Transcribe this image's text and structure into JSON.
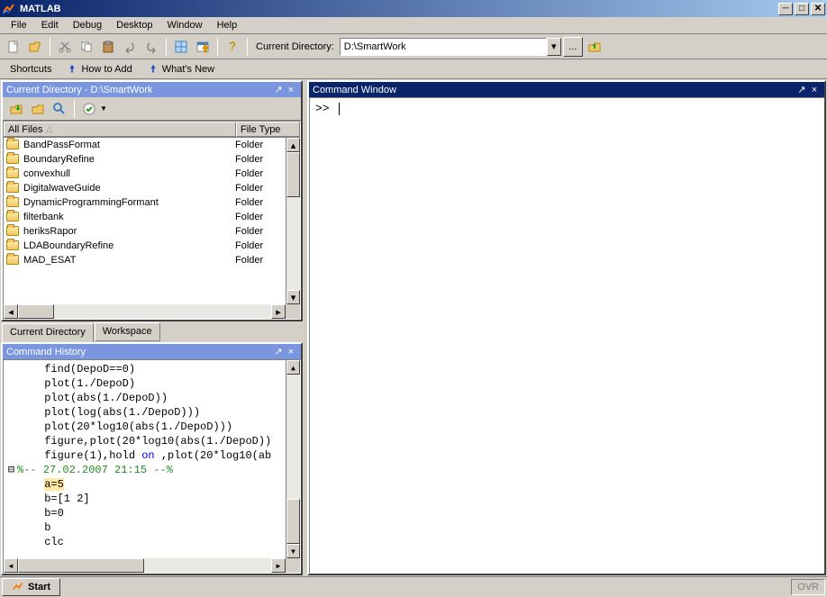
{
  "title": "MATLAB",
  "menubar": [
    "File",
    "Edit",
    "Debug",
    "Desktop",
    "Window",
    "Help"
  ],
  "toolbar": {
    "curdir_label": "Current Directory:",
    "curdir_value": "D:\\SmartWork"
  },
  "shortcuts": {
    "label": "Shortcuts",
    "howto": "How to Add",
    "whatsnew": "What's New"
  },
  "curdir_panel": {
    "title": "Current Directory - D:\\SmartWork",
    "cols": {
      "allfiles": "All Files",
      "filetype": "File Type"
    },
    "rows": [
      {
        "name": "BandPassFormat",
        "type": "Folder"
      },
      {
        "name": "BoundaryRefine",
        "type": "Folder"
      },
      {
        "name": "convexhull",
        "type": "Folder"
      },
      {
        "name": "DigitalwaveGuide",
        "type": "Folder"
      },
      {
        "name": "DynamicProgrammingFormant",
        "type": "Folder"
      },
      {
        "name": "filterbank",
        "type": "Folder"
      },
      {
        "name": "heriksRapor",
        "type": "Folder"
      },
      {
        "name": "LDABoundaryRefine",
        "type": "Folder"
      },
      {
        "name": "MAD_ESAT",
        "type": "Folder"
      }
    ],
    "tabs": {
      "current": "Current Directory",
      "workspace": "Workspace"
    }
  },
  "history_panel": {
    "title": "Command History",
    "lines": [
      {
        "indent": 3,
        "text": "find(DepoD==0)"
      },
      {
        "indent": 3,
        "text": "plot(1./DepoD)"
      },
      {
        "indent": 3,
        "text": "plot(abs(1./DepoD))"
      },
      {
        "indent": 3,
        "text": "plot(log(abs(1./DepoD)))"
      },
      {
        "indent": 3,
        "text": "plot(20*log10(abs(1./DepoD)))"
      },
      {
        "indent": 3,
        "text": "figure,plot(20*log10(abs(1./DepoD))"
      },
      {
        "indent": 3,
        "pre": "figure(1),hold ",
        "kw": "on",
        "post": " ,plot(20*log10(ab"
      },
      {
        "indent": 1,
        "tree": "⊟",
        "comment": "%-- 27.02.2007 21:15 --%"
      },
      {
        "indent": 3,
        "sel": true,
        "text": "a=5"
      },
      {
        "indent": 3,
        "text": "b=[1 2]"
      },
      {
        "indent": 3,
        "text": "b=0"
      },
      {
        "indent": 3,
        "text": "b"
      },
      {
        "indent": 3,
        "text": "clc"
      }
    ]
  },
  "cmdwin": {
    "title": "Command Window",
    "prompt": ">> "
  },
  "statusbar": {
    "start": "Start",
    "ovr": "OVR"
  }
}
